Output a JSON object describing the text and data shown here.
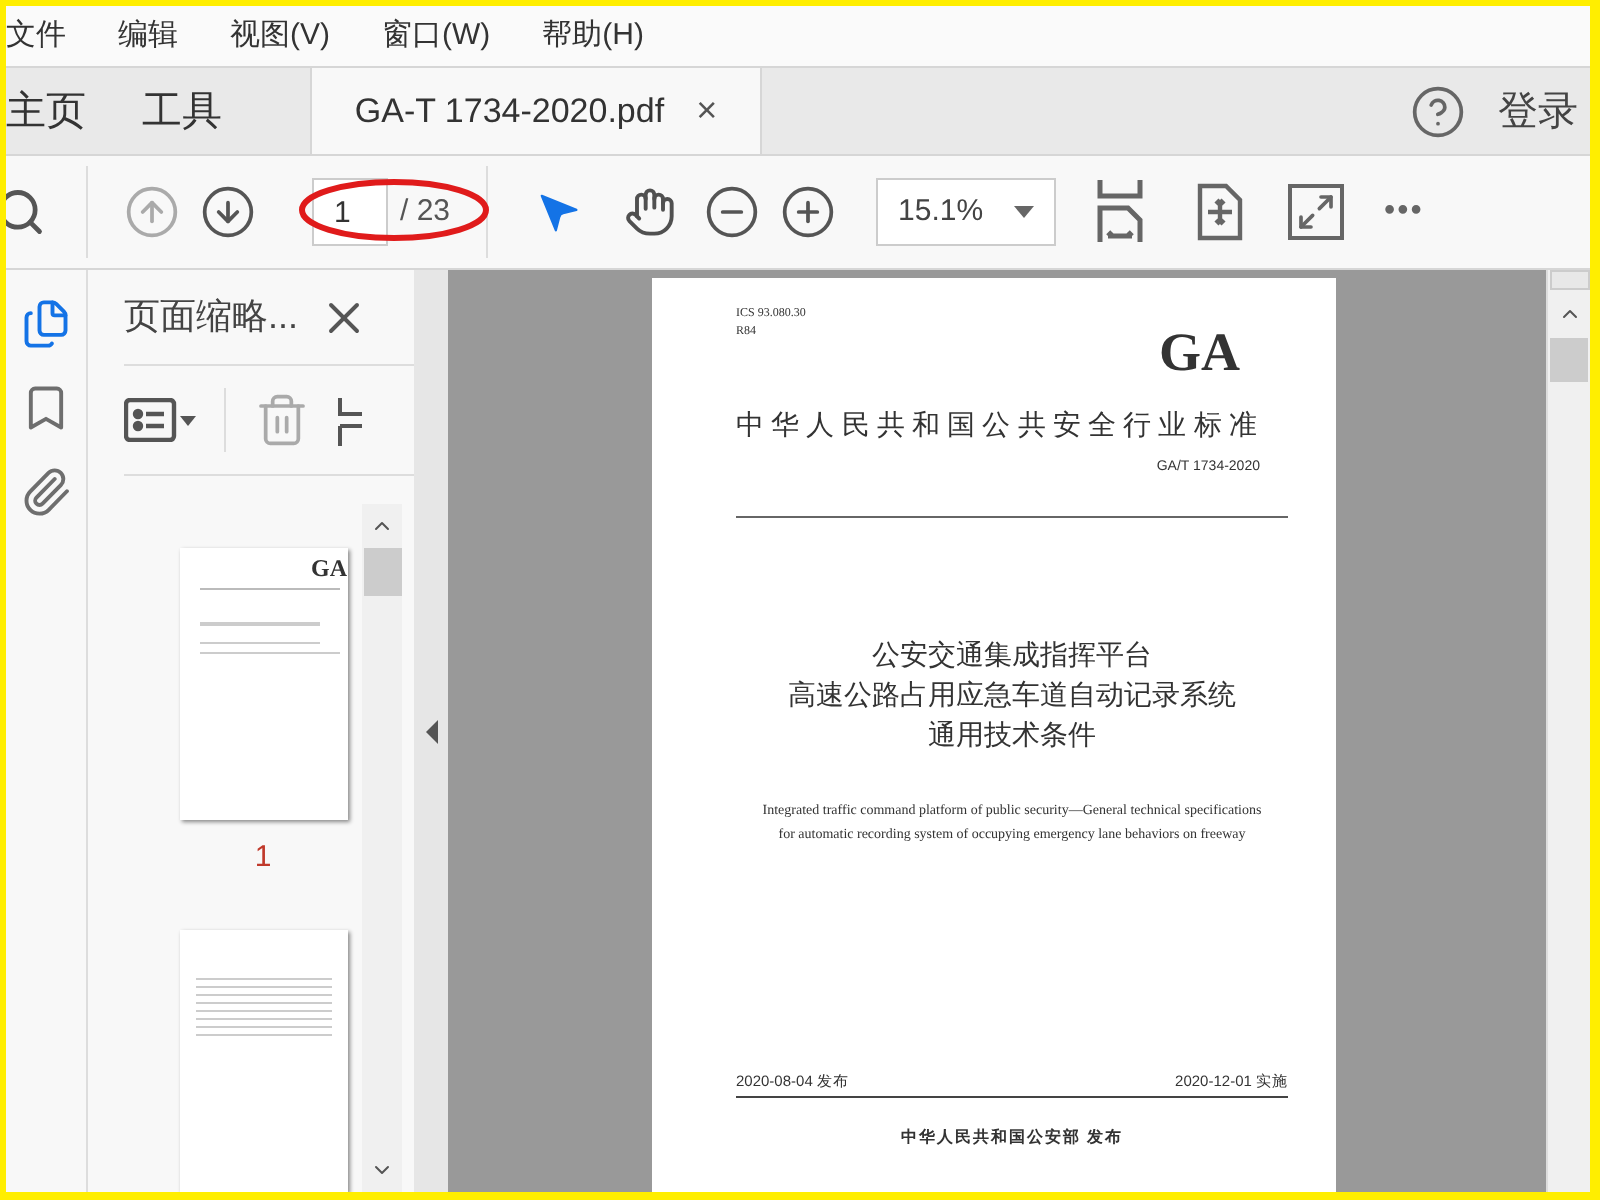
{
  "menu": [
    "文件",
    "编辑",
    "视图(V)",
    "窗口(W)",
    "帮助(H)"
  ],
  "tabs": [
    {
      "label": "主页",
      "kind": "nav",
      "selected": false
    },
    {
      "label": "工具",
      "kind": "nav",
      "selected": false
    },
    {
      "label": "GA-T 1734-2020.pdf",
      "kind": "document",
      "selected": true,
      "close": "×"
    }
  ],
  "account": {
    "login": "登录"
  },
  "toolbar": {
    "prev_disabled": true,
    "next_disabled": false,
    "page_value": "1",
    "page_count": "/ 23",
    "page_highlight": true,
    "tools": [
      {
        "kind": "select",
        "selected": true
      },
      {
        "kind": "hand",
        "selected": false
      }
    ],
    "zoom": "15.1%",
    "more": "•••"
  },
  "rail": [
    {
      "kind": "pages",
      "selected": true
    },
    {
      "kind": "bookmarks",
      "selected": false
    },
    {
      "kind": "attachments",
      "selected": false
    }
  ],
  "panel": {
    "title": "页面缩略...",
    "delete_disabled": true,
    "thumbnails": [
      {
        "kind": "cover",
        "mark": "GA",
        "label": "1"
      },
      {
        "kind": "contents"
      }
    ]
  },
  "document": {
    "codes": [
      "ICS 93.080.30",
      "R84"
    ],
    "logo": "GA",
    "heading": "中华人民共和国公共安全行业标准",
    "number": "GA/T 1734-2020",
    "title": [
      "公安交通集成指挥平台",
      "高速公路占用应急车道自动记录系统",
      "通用技术条件"
    ],
    "english": "Integrated traffic command platform of public security—General technical specifications for automatic recording system of occupying emergency lane behaviors on freeway",
    "issued": "2020-08-04  发布",
    "effective": "2020-12-01  实施",
    "publisher": "中华人民共和国公安部  发布"
  }
}
